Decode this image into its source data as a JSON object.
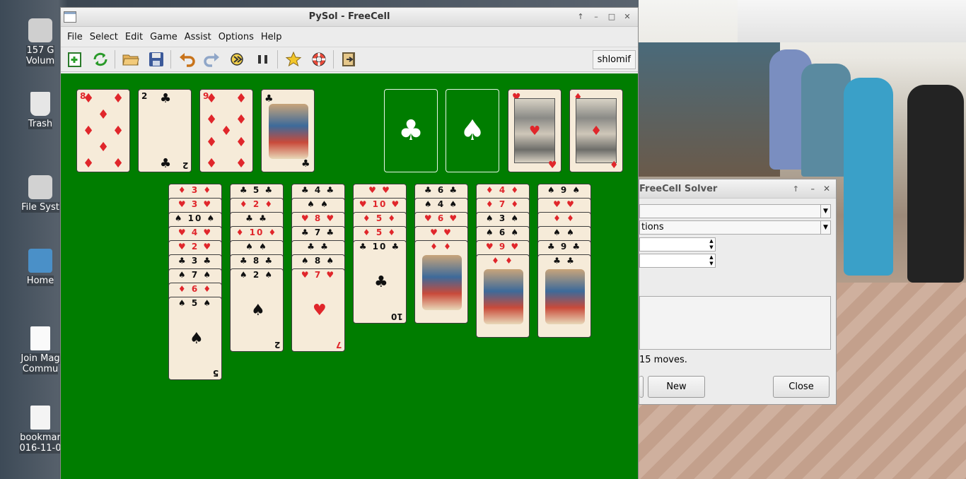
{
  "window": {
    "title": "PySol - FreeCell",
    "controls": [
      "↑",
      "–",
      "□",
      "✕"
    ]
  },
  "menu": [
    "File",
    "Select",
    "Edit",
    "Game",
    "Assist",
    "Options",
    "Help"
  ],
  "toolbar": {
    "buttons": [
      "new-game",
      "restart",
      "open",
      "save",
      "undo",
      "redo",
      "autodrop",
      "pause",
      "statistics",
      "rules",
      "quit"
    ],
    "player": "shlomif"
  },
  "desktop": {
    "icons": [
      {
        "label_line1": "157 G",
        "label_line2": "Volum"
      },
      {
        "label_line1": "Trash",
        "label_line2": ""
      },
      {
        "label_line1": "File Syst",
        "label_line2": ""
      },
      {
        "label_line1": "Home",
        "label_line2": ""
      },
      {
        "label_line1": "Join Mag",
        "label_line2": "Commu"
      },
      {
        "label_line1": "bookmar",
        "label_line2": "016-11-0"
      }
    ]
  },
  "game": {
    "freecells": [
      {
        "rank": "8",
        "suit": "♦",
        "color": "red"
      },
      {
        "rank": "2",
        "suit": "♣",
        "color": "black"
      },
      {
        "rank": "9",
        "suit": "♦",
        "color": "red"
      },
      {
        "rank": "J",
        "suit": "♣",
        "color": "black"
      }
    ],
    "foundations": [
      {
        "suit": "♣",
        "empty": true
      },
      {
        "suit": "♠",
        "empty": true
      },
      {
        "suit": "♥",
        "empty": false
      },
      {
        "suit": "♦",
        "empty": false
      }
    ],
    "tableau": [
      [
        {
          "rank": "3",
          "suit": "♦",
          "color": "red"
        },
        {
          "rank": "3",
          "suit": "♥",
          "color": "red"
        },
        {
          "rank": "10",
          "suit": "♠",
          "color": "black"
        },
        {
          "rank": "4",
          "suit": "♥",
          "color": "red"
        },
        {
          "rank": "2",
          "suit": "♥",
          "color": "red"
        },
        {
          "rank": "3",
          "suit": "♣",
          "color": "black"
        },
        {
          "rank": "7",
          "suit": "♠",
          "color": "black"
        },
        {
          "rank": "6",
          "suit": "♦",
          "color": "red"
        },
        {
          "rank": "5",
          "suit": "♠",
          "color": "black"
        }
      ],
      [
        {
          "rank": "5",
          "suit": "♣",
          "color": "black"
        },
        {
          "rank": "2",
          "suit": "♦",
          "color": "red"
        },
        {
          "rank": "",
          "suit": "♣",
          "color": "black"
        },
        {
          "rank": "10",
          "suit": "♦",
          "color": "red"
        },
        {
          "rank": "",
          "suit": "♠",
          "color": "black"
        },
        {
          "rank": "8",
          "suit": "♣",
          "color": "black"
        },
        {
          "rank": "2",
          "suit": "♠",
          "color": "black"
        }
      ],
      [
        {
          "rank": "4",
          "suit": "♣",
          "color": "black"
        },
        {
          "rank": "",
          "suit": "♠",
          "color": "black"
        },
        {
          "rank": "8",
          "suit": "♥",
          "color": "red"
        },
        {
          "rank": "7",
          "suit": "♣",
          "color": "black"
        },
        {
          "rank": "",
          "suit": "♣",
          "color": "black"
        },
        {
          "rank": "8",
          "suit": "♠",
          "color": "black"
        },
        {
          "rank": "7",
          "suit": "♥",
          "color": "red"
        }
      ],
      [
        {
          "rank": "",
          "suit": "♥",
          "color": "red"
        },
        {
          "rank": "10",
          "suit": "♥",
          "color": "red"
        },
        {
          "rank": "5",
          "suit": "♦",
          "color": "red"
        },
        {
          "rank": "5",
          "suit": "♦",
          "color": "red"
        },
        {
          "rank": "10",
          "suit": "♣",
          "color": "black"
        }
      ],
      [
        {
          "rank": "6",
          "suit": "♣",
          "color": "black"
        },
        {
          "rank": "4",
          "suit": "♠",
          "color": "black"
        },
        {
          "rank": "6",
          "suit": "♥",
          "color": "red"
        },
        {
          "rank": "",
          "suit": "♥",
          "color": "red"
        },
        {
          "rank": "",
          "suit": "♦",
          "color": "red"
        }
      ],
      [
        {
          "rank": "4",
          "suit": "♦",
          "color": "red"
        },
        {
          "rank": "7",
          "suit": "♦",
          "color": "red"
        },
        {
          "rank": "3",
          "suit": "♠",
          "color": "black"
        },
        {
          "rank": "6",
          "suit": "♠",
          "color": "black"
        },
        {
          "rank": "9",
          "suit": "♥",
          "color": "red"
        },
        {
          "rank": "",
          "suit": "♦",
          "color": "red"
        }
      ],
      [
        {
          "rank": "9",
          "suit": "♠",
          "color": "black"
        },
        {
          "rank": "",
          "suit": "♥",
          "color": "red"
        },
        {
          "rank": "",
          "suit": "♦",
          "color": "red"
        },
        {
          "rank": "",
          "suit": "♠",
          "color": "black"
        },
        {
          "rank": "9",
          "suit": "♣",
          "color": "black"
        },
        {
          "rank": "",
          "suit": "♣",
          "color": "black"
        }
      ]
    ]
  },
  "solver": {
    "title": "FreeCell Solver",
    "combo1": "",
    "combo2": "tions",
    "status": "15 moves.",
    "new_label": "New",
    "close_label": "Close"
  },
  "colors": {
    "felt": "#007d00",
    "card_face": "#f6ebd9",
    "red_suit": "#e0262b"
  }
}
